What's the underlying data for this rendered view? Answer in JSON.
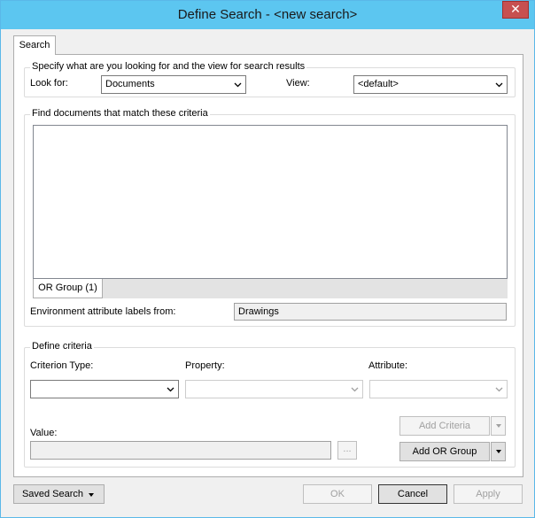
{
  "window": {
    "title": "Define Search - <new search>",
    "close_glyph": "✕"
  },
  "tabs": {
    "search": "Search"
  },
  "view_group": {
    "legend": "Specify what are you looking for and the view for search results",
    "look_for_label": "Look for:",
    "look_for_value": "Documents",
    "view_label": "View:",
    "view_value": "<default>"
  },
  "match_group": {
    "legend": "Find documents that match these criteria",
    "or_group_tab": "OR Group (1)",
    "env_label": "Environment attribute labels from:",
    "env_value": "Drawings"
  },
  "criteria_group": {
    "legend": "Define criteria",
    "criterion_type_label": "Criterion Type:",
    "criterion_type_value": "",
    "property_label": "Property:",
    "property_value": "",
    "attribute_label": "Attribute:",
    "attribute_value": "",
    "value_label": "Value:",
    "value_value": "",
    "browse_label": "...",
    "add_criteria_label": "Add Criteria",
    "add_or_group_label": "Add OR Group"
  },
  "footer": {
    "saved_search_label": "Saved Search",
    "ok_label": "OK",
    "cancel_label": "Cancel",
    "apply_label": "Apply"
  },
  "icons": {
    "close": "close-icon",
    "dropdown": "chevron-down-icon",
    "split_arrow": "caret-down-icon"
  },
  "colors": {
    "titlebar": "#5cc6f0",
    "close_button": "#c75050",
    "window_bg": "#f0f0f0"
  }
}
